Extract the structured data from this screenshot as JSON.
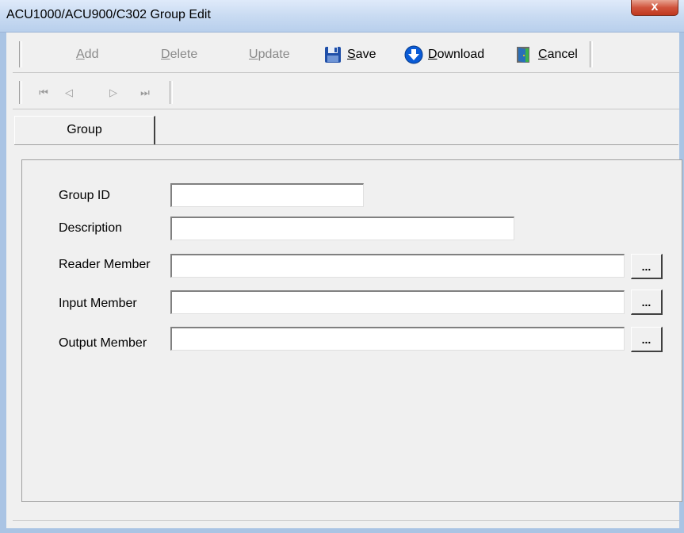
{
  "window": {
    "title": "ACU1000/ACU900/C302 Group Edit",
    "close_glyph": "x"
  },
  "toolbar": {
    "add_label": "Add",
    "delete_label": "Delete",
    "update_label": "Update",
    "save_label": "Save",
    "download_label": "Download",
    "cancel_label": "Cancel",
    "icons": {
      "save": "floppy-disk-icon",
      "download": "download-arrow-icon",
      "cancel": "door-exit-icon"
    }
  },
  "navigation": {
    "first_glyph": "⏮",
    "prev_glyph": "◁",
    "next_glyph": "▷",
    "last_glyph": "⏭"
  },
  "tabs": [
    {
      "label": "Group",
      "selected": true
    }
  ],
  "form": {
    "group_id": {
      "label": "Group ID",
      "value": ""
    },
    "description": {
      "label": "Description",
      "value": ""
    },
    "reader_member": {
      "label": "Reader Member",
      "value": "",
      "browse_label": "..."
    },
    "input_member": {
      "label": "Input Member",
      "value": "",
      "browse_label": "..."
    },
    "output_member": {
      "label": "Output Member",
      "value": "",
      "browse_label": "..."
    }
  },
  "colors": {
    "titlebar": "#c9dbf2",
    "frame": "#aac4e4",
    "close": "#c0381f",
    "face": "#f0f0f0",
    "disabled_text": "#8a8a8a",
    "save_icon": "#1f4fa8",
    "download_icon": "#0a5bd6",
    "cancel_icon": "#2a6fb8"
  }
}
